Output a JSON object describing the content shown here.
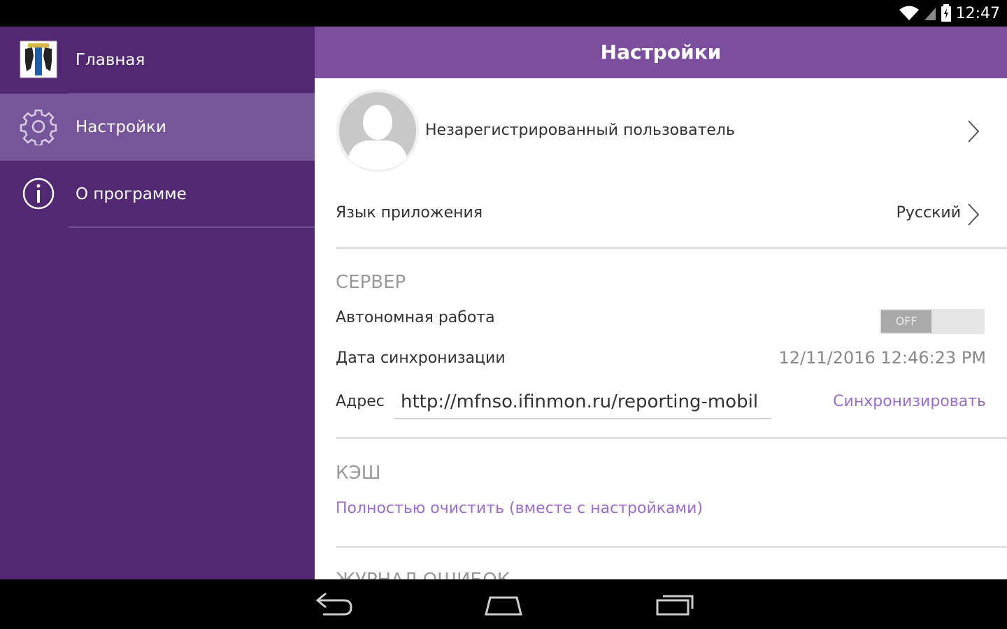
{
  "status": {
    "time": "12:47"
  },
  "sidebar": {
    "items": [
      {
        "label": "Главная",
        "icon": "coat-of-arms-icon"
      },
      {
        "label": "Настройки",
        "icon": "gear-icon"
      },
      {
        "label": "О программе",
        "icon": "info-icon"
      }
    ]
  },
  "header": {
    "title": "Настройки"
  },
  "profile": {
    "name": "Незарегистрированный пользователь"
  },
  "language": {
    "label": "Язык приложения",
    "value": "Русский"
  },
  "server": {
    "section_title": "СЕРВЕР",
    "offline_label": "Автономная работа",
    "offline_toggle": "OFF",
    "sync_date_label": "Дата синхронизации",
    "sync_date_value": "12/11/2016 12:46:23 PM",
    "address_label": "Адрес",
    "address_value": "http://mfnso.ifinmon.ru/reporting-mobil",
    "sync_button": "Синхронизировать"
  },
  "cache": {
    "section_title": "КЭШ",
    "clear_link": "Полностью очистить (вместе с настройками)"
  },
  "error_log": {
    "section_title": "ЖУРНАЛ ОШИБОК"
  },
  "colors": {
    "sidebar": "#532873",
    "sidebar_active": "#77559a",
    "header": "#7b4f9d",
    "accent_link": "#9b6dc9"
  }
}
